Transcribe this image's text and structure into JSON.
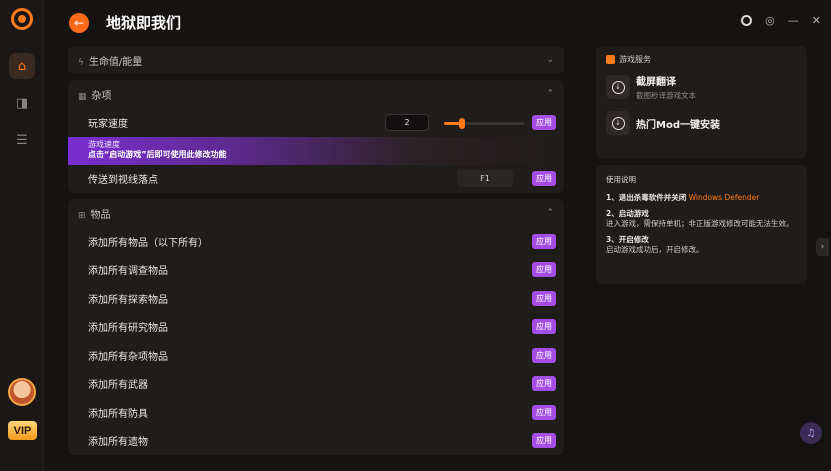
{
  "header": {
    "title": "地狱即我们"
  },
  "sections": {
    "health": {
      "title": "生命值/能量"
    },
    "misc": {
      "title": "杂项",
      "player_speed": {
        "label": "玩家速度",
        "value": "2",
        "apply": "应用",
        "level": 0.22
      },
      "tip": {
        "line1": "游戏速度",
        "line2": "点击“启动游戏”后即可使用此修改功能"
      },
      "teleport": {
        "label": "传送到视线落点",
        "key": "F1",
        "apply": "应用"
      }
    },
    "items": {
      "title": "物品",
      "rows": [
        {
          "label": "添加所有物品（以下所有）",
          "apply": "应用"
        },
        {
          "label": "添加所有调查物品",
          "apply": "应用"
        },
        {
          "label": "添加所有探索物品",
          "apply": "应用"
        },
        {
          "label": "添加所有研究物品",
          "apply": "应用"
        },
        {
          "label": "添加所有杂项物品",
          "apply": "应用"
        },
        {
          "label": "添加所有武器",
          "apply": "应用"
        },
        {
          "label": "添加所有防具",
          "apply": "应用"
        },
        {
          "label": "添加所有遗物",
          "apply": "应用"
        }
      ]
    }
  },
  "services": {
    "title": "游戏服务",
    "items": [
      {
        "title": "截屏翻译",
        "subtitle": "截图秒译游戏文本"
      },
      {
        "title": "热门Mod一键安装",
        "subtitle": ""
      }
    ]
  },
  "guide": {
    "title": "使用说明",
    "step1_prefix": "1、退出杀毒软件并关闭",
    "step1_highlight": "Windows Defender",
    "step2_title": "2、启动游戏",
    "step2_body": "进入游戏，需保持单机；非正版游戏修改可能无法生效。",
    "step3_title": "3、开启修改",
    "step3_body": "启动游戏成功后，开启修改。"
  },
  "rail": {
    "vip_label": "VIP"
  },
  "colors": {
    "accent": "#ff7a1a",
    "apply": "#a54ee6",
    "background": "#151311",
    "panel": "#1f1c1a"
  }
}
